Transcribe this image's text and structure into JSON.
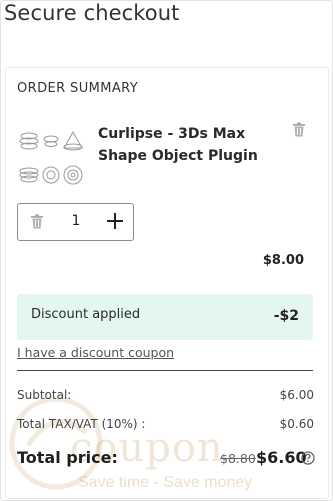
{
  "page": {
    "title": "Secure checkout"
  },
  "summary": {
    "heading": "ORDER SUMMARY",
    "product": {
      "name": "Curlipse - 3Ds Max Shape Object Plugin",
      "quantity": "1",
      "price": "$8.00"
    },
    "discount": {
      "label": "Discount applied",
      "value": "-$2"
    },
    "coupon_link": "I have a discount coupon",
    "subtotal": {
      "label": "Subtotal:",
      "value": "$6.00"
    },
    "tax": {
      "label": "Total TAX/VAT (10%) :",
      "value": "$0.60"
    },
    "total": {
      "label": "Total price:",
      "old_value": "$8.80",
      "value": "$6.60"
    }
  },
  "watermark": {
    "word": "coupon",
    "tagline": "Save time - Save money"
  },
  "icons": {
    "remove_item": "trash-icon",
    "decrease_quantity": "trash-icon",
    "increase_quantity": "plus-icon",
    "total_help": "question-circle-icon"
  },
  "colors": {
    "discount_bg": "#e3f7ee",
    "text": "#222222",
    "watermark": "#c8a06e"
  }
}
